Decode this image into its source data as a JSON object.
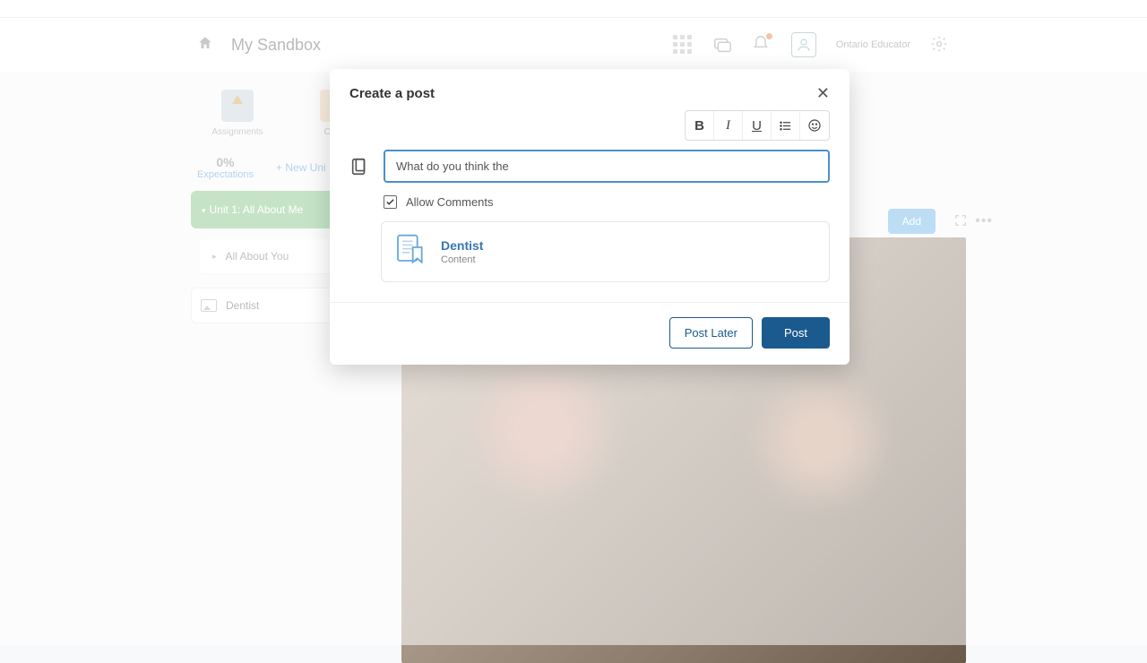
{
  "header": {
    "brand": "My Sandbox",
    "user": "Ontario Educator"
  },
  "toolbar": {
    "assignments": "Assignments",
    "course": "Cours"
  },
  "subrow": {
    "exp_pct": "0%",
    "exp_lbl": "Expectations",
    "new_unit": "+  New Uni"
  },
  "sidebar": {
    "unit1": "Unit 1: All About Me",
    "sub1": "All About You",
    "dentist": "Dentist"
  },
  "add_btn": "Add",
  "modal": {
    "title": "Create a post",
    "input_value": "What do you think the",
    "fmt": {
      "b": "B",
      "i": "I",
      "u": "U"
    },
    "allow_comments": "Allow Comments",
    "attachment": {
      "title": "Dentist",
      "subtitle": "Content"
    },
    "post_later": "Post Later",
    "post": "Post"
  }
}
